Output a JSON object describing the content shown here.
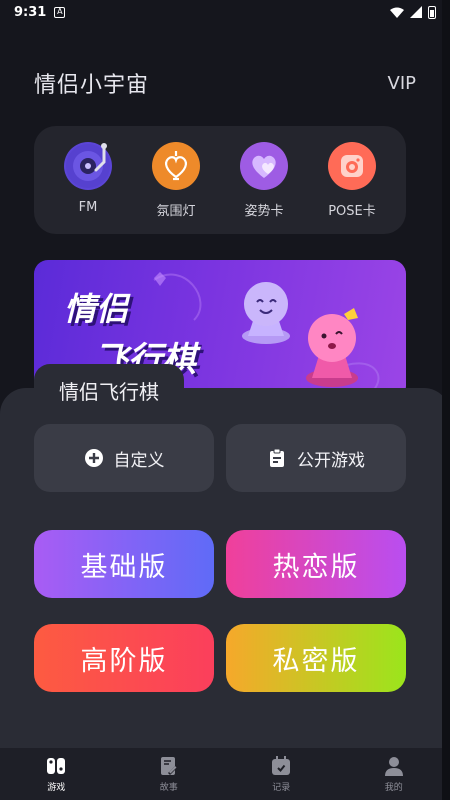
{
  "status_bar": {
    "time": "9:31",
    "notif": "A"
  },
  "header": {
    "title": "情侣小宇宙",
    "vip": "VIP"
  },
  "tools": [
    {
      "label": "FM",
      "icon": "vinyl-record-icon",
      "color": "#6a4be0"
    },
    {
      "label": "氛围灯",
      "icon": "heart-lamp-icon",
      "color": "#f08a2c"
    },
    {
      "label": "姿势卡",
      "icon": "heart-card-icon",
      "color": "#a35de6"
    },
    {
      "label": "POSE卡",
      "icon": "camera-icon",
      "color": "#ff6e5b"
    }
  ],
  "banner": {
    "title_line1": "情侣",
    "title_line2": "飞行棋"
  },
  "sheet": {
    "title": "情侣飞行棋",
    "custom_label": "自定义",
    "public_label": "公开游戏"
  },
  "modes": {
    "basic": "基础版",
    "love": "热恋版",
    "advanced": "高阶版",
    "private": "私密版"
  },
  "nav": {
    "games": "游戏",
    "stories": "故事",
    "records": "记录",
    "mine": "我的",
    "active": "games"
  },
  "colors": {
    "background": "#15161d",
    "card": "#24252d",
    "sheet": "#2a2c35",
    "button": "#3a3c46"
  }
}
